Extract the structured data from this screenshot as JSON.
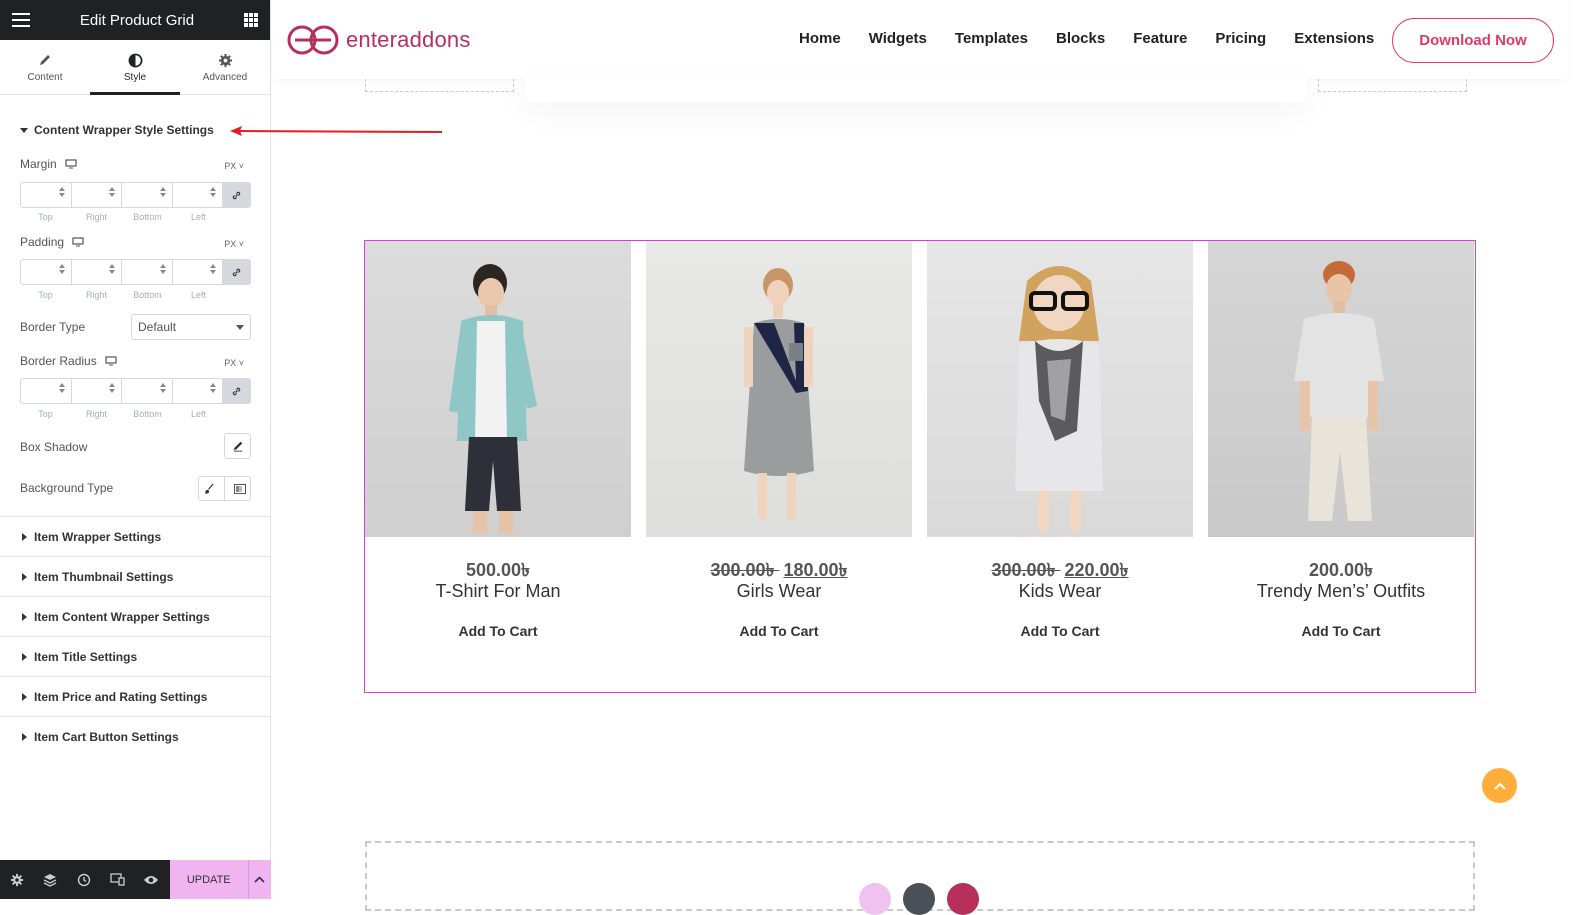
{
  "sidebar": {
    "title": "Edit Product Grid",
    "tabs": [
      {
        "label": "Content",
        "icon": "pencil-icon"
      },
      {
        "label": "Style",
        "icon": "contrast-icon"
      },
      {
        "label": "Advanced",
        "icon": "gear-icon"
      }
    ],
    "open_section": "Content Wrapper Style Settings",
    "margin_label": "Margin",
    "padding_label": "Padding",
    "border_radius_label": "Border Radius",
    "unit": "PX",
    "dim_labels": [
      "Top",
      "Right",
      "Bottom",
      "Left"
    ],
    "border_type_label": "Border Type",
    "border_type_value": "Default",
    "box_shadow_label": "Box Shadow",
    "background_type_label": "Background Type",
    "sections": [
      "Item Wrapper Settings",
      "Item Thumbnail Settings",
      "Item Content Wrapper Settings",
      "Item Title Settings",
      "Item Price and Rating Settings",
      "Item Cart Button Settings"
    ],
    "update_label": "UPDATE"
  },
  "header": {
    "logo_text": "enteraddons",
    "nav": [
      "Home",
      "Widgets",
      "Templates",
      "Blocks",
      "Feature",
      "Pricing",
      "Extensions"
    ],
    "cta": "Download Now"
  },
  "products": [
    {
      "old_price": "",
      "price": "500.00৳",
      "name": "T-Shirt For Man",
      "cart": "Add To Cart"
    },
    {
      "old_price": "300.00৳",
      "price": "180.00৳",
      "name": "Girls Wear",
      "cart": "Add To Cart"
    },
    {
      "old_price": "300.00৳",
      "price": "220.00৳",
      "name": "Kids Wear",
      "cart": "Add To Cart"
    },
    {
      "old_price": "",
      "price": "200.00৳",
      "name": "Trendy Men’s’ Outfits",
      "cart": "Add To Cart"
    }
  ],
  "colors": {
    "brand": "#b7305c",
    "accent_border": "#d63ddc",
    "cta": "#e03b64",
    "scroll_top": "#ffae3b",
    "update_bg": "#f0b4f0"
  }
}
